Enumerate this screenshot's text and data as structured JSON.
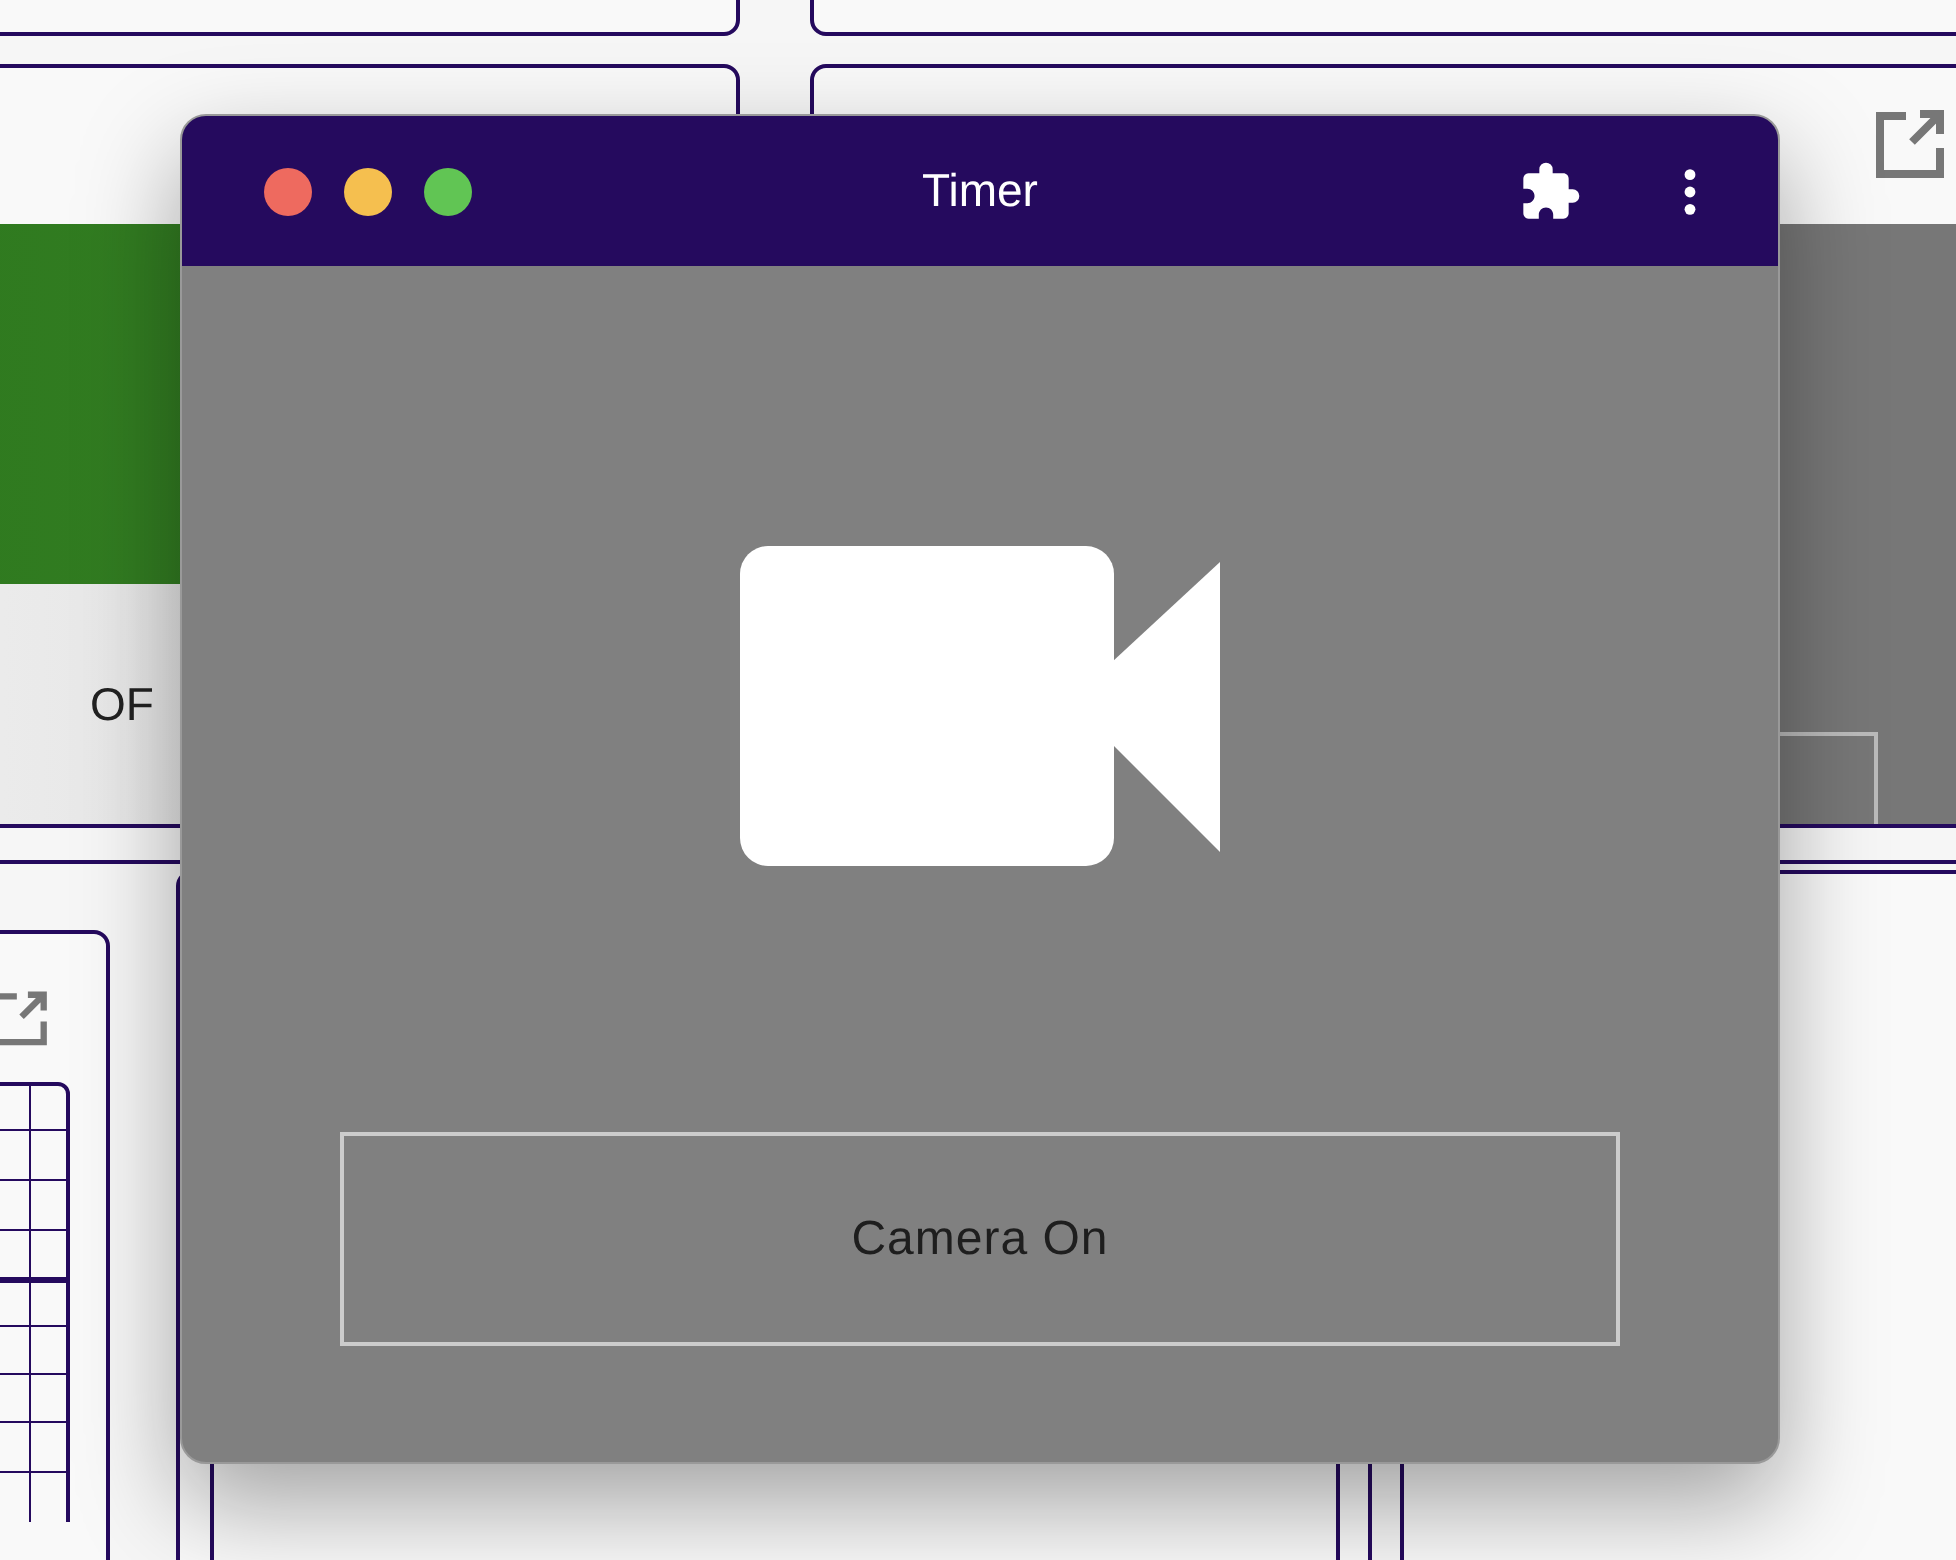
{
  "backdrop": {
    "status_label": "OF"
  },
  "window": {
    "title": "Timer",
    "camera_button": "Camera On"
  }
}
